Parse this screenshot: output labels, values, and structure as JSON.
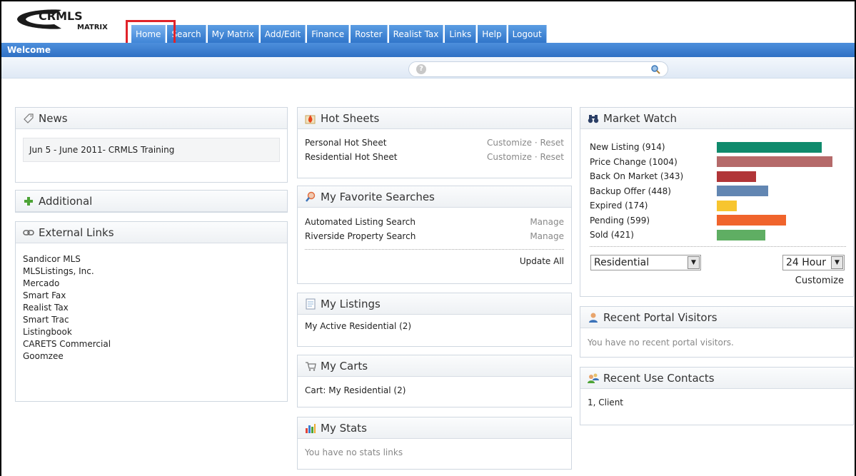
{
  "logo": {
    "line1": "CRMLS",
    "line2": "MATRIX"
  },
  "nav": [
    "Home",
    "Search",
    "My Matrix",
    "Add/Edit",
    "Finance",
    "Roster",
    "Realist Tax",
    "Links",
    "Help",
    "Logout"
  ],
  "welcome": "Welcome",
  "quicksearch": {
    "help": "?",
    "placeholder": ""
  },
  "news": {
    "title": "News",
    "item": "Jun 5 - June 2011- CRMLS Training"
  },
  "additional": {
    "title": "Additional"
  },
  "external_links": {
    "title": "External Links",
    "items": [
      "Sandicor MLS",
      "MLSListings, Inc.",
      "Mercado",
      "Smart Fax",
      "Realist Tax",
      "Smart Trac",
      "Listingbook",
      "CARETS Commercial",
      "Goomzee"
    ]
  },
  "hot_sheets": {
    "title": "Hot Sheets",
    "items": [
      {
        "name": "Personal Hot Sheet",
        "customize": "Customize",
        "sep": "·",
        "reset": "Reset"
      },
      {
        "name": "Residential Hot Sheet",
        "customize": "Customize",
        "sep": "·",
        "reset": "Reset"
      }
    ]
  },
  "fav_searches": {
    "title": "My Favorite Searches",
    "items": [
      {
        "name": "Automated Listing Search",
        "action": "Manage"
      },
      {
        "name": "Riverside Property Search",
        "action": "Manage"
      }
    ],
    "update_all": "Update All"
  },
  "my_listings": {
    "title": "My Listings",
    "item": "My Active Residential (2)"
  },
  "my_carts": {
    "title": "My Carts",
    "item": "Cart: My Residential (2)"
  },
  "my_stats": {
    "title": "My Stats",
    "empty": "You have no stats links"
  },
  "market_watch": {
    "title": "Market Watch",
    "items": [
      {
        "label": "New Listing (914)",
        "value": 914,
        "color": "#0f8a6c"
      },
      {
        "label": "Price Change (1004)",
        "value": 1004,
        "color": "#b56a6a"
      },
      {
        "label": "Back On Market (343)",
        "value": 343,
        "color": "#b13538"
      },
      {
        "label": "Backup Offer (448)",
        "value": 448,
        "color": "#6286b2"
      },
      {
        "label": "Expired (174)",
        "value": 174,
        "color": "#f7c52f"
      },
      {
        "label": "Pending (599)",
        "value": 599,
        "color": "#f0642c"
      },
      {
        "label": "Sold (421)",
        "value": 421,
        "color": "#5fae63"
      }
    ],
    "max": 1004,
    "property_type": "Residential",
    "period": "24 Hour",
    "customize": "Customize"
  },
  "portal_visitors": {
    "title": "Recent Portal Visitors",
    "empty": "You have no recent portal visitors."
  },
  "use_contacts": {
    "title": "Recent Use Contacts",
    "item": "1, Client"
  }
}
